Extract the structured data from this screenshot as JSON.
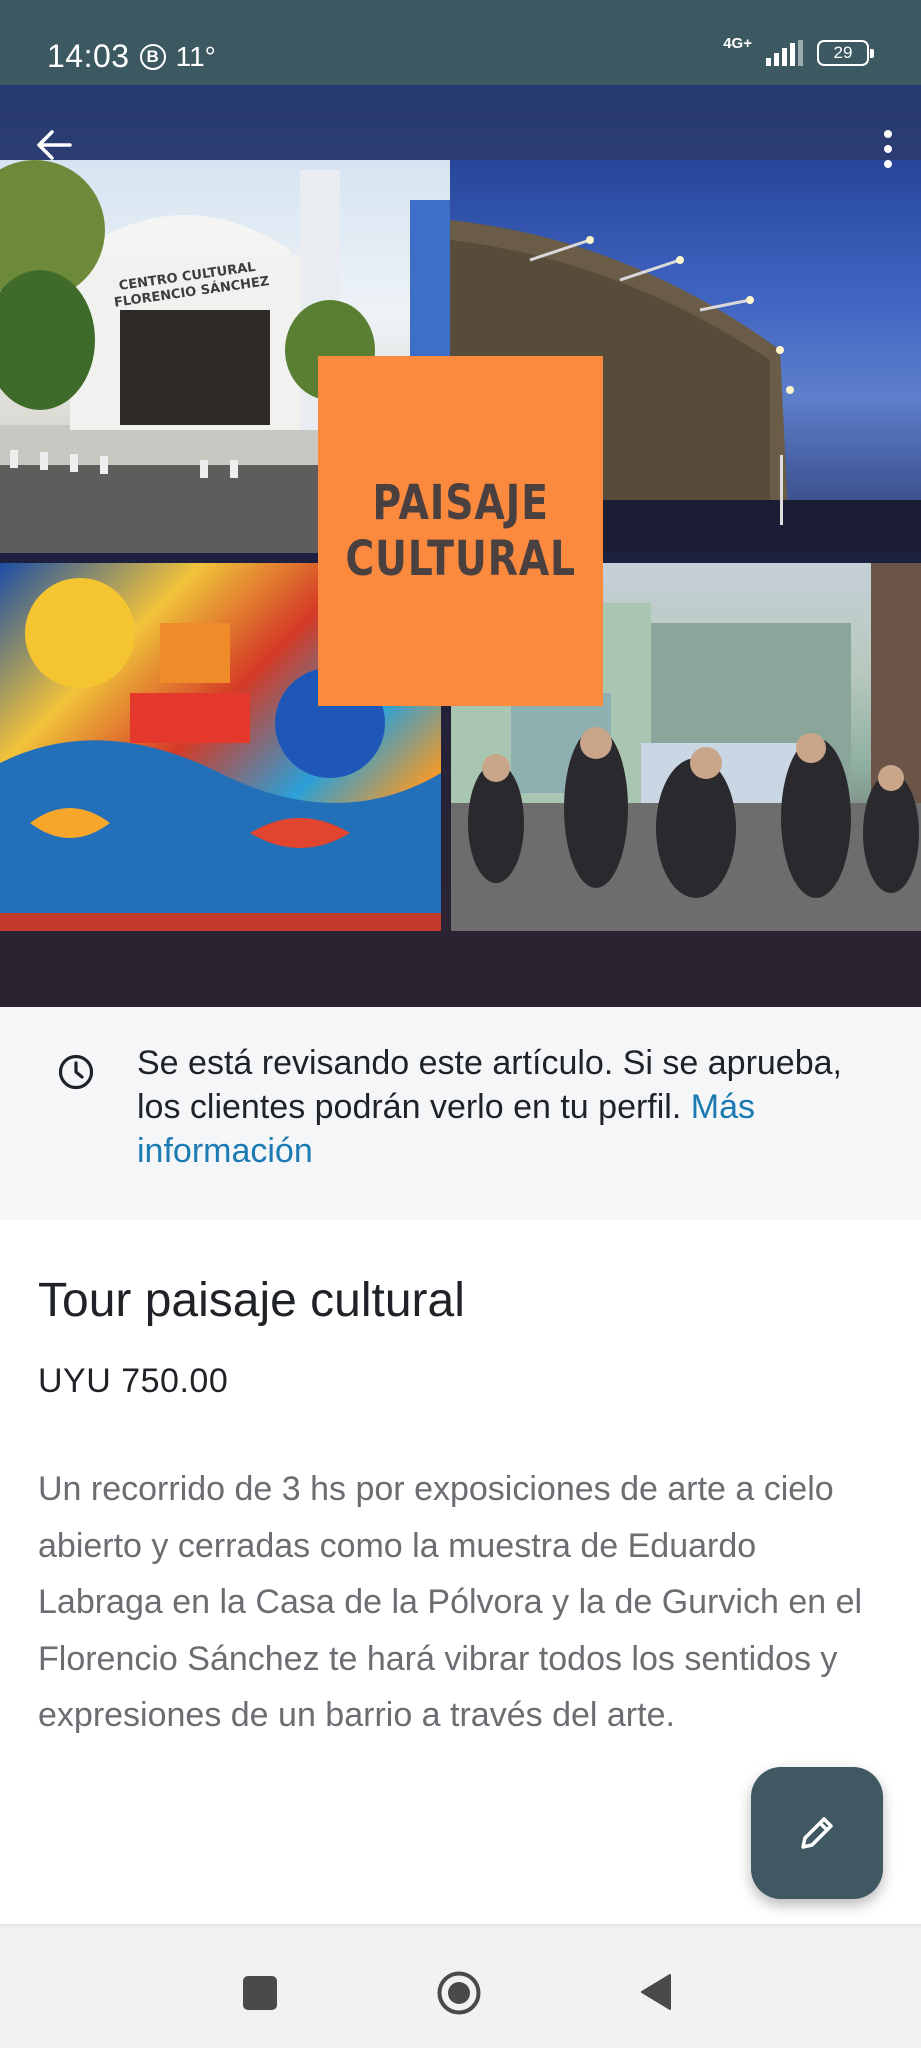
{
  "status_bar": {
    "time": "14:03",
    "indicator_letter": "B",
    "temperature": "11°",
    "network": "4G+",
    "battery": "29"
  },
  "hero": {
    "card_title": "PAISAJE\nCULTURAL",
    "building_sign": "CENTRO CULTURAL\nFLORENCIO SÁNCHEZ"
  },
  "notice": {
    "text": "Se está revisando este artículo. Si se aprueba, los clientes podrán verlo en tu perfil.",
    "link": "Más información"
  },
  "product": {
    "title": "Tour paisaje cultural",
    "price": "UYU 750.00",
    "description": "Un recorrido de 3 hs por exposiciones de arte a cielo abierto y cerradas como la muestra de Eduardo Labraga en la Casa de la Pólvora y la de Gurvich en el Florencio Sánchez te hará vibrar todos los sentidos y expresiones de un barrio a través del arte."
  },
  "icons": {
    "back": "arrow-back-icon",
    "menu": "more-vert-icon",
    "clock": "clock-icon",
    "edit": "pencil-icon",
    "nav_recents": "square-icon",
    "nav_home": "circle-icon",
    "nav_back": "triangle-icon"
  },
  "colors": {
    "status_bar": "#3c5860",
    "card": "#fb8a3e",
    "link": "#1c7ab3",
    "fab": "#3f5862"
  }
}
